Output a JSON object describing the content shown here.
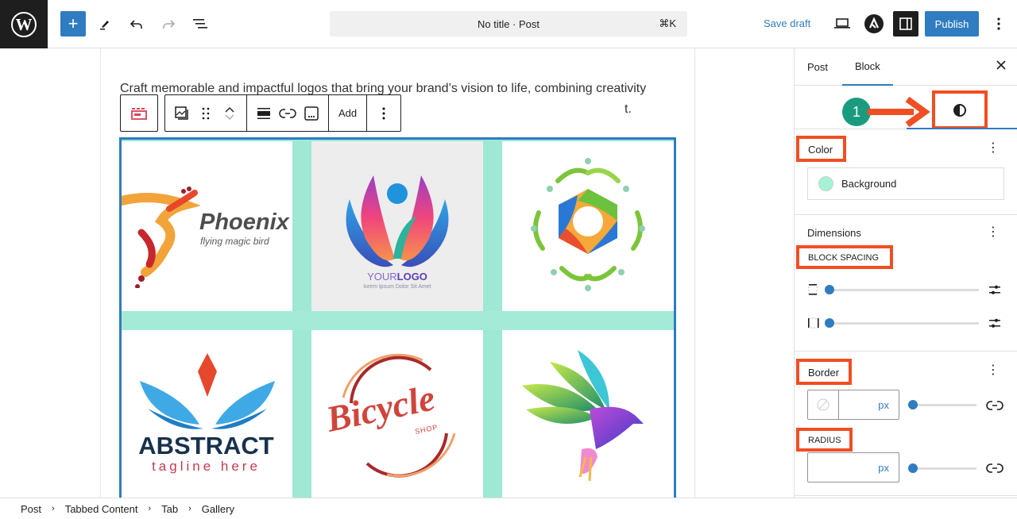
{
  "topbar": {
    "add_block_label": "+",
    "command_bar": {
      "title": "No title · Post",
      "shortcut": "⌘K"
    },
    "save_draft": "Save draft",
    "publish": "Publish"
  },
  "editor": {
    "paragraph": "Craft memorable and impactful logos that bring your brand’s vision to life, combining creativity",
    "paragraph_tail": "t.",
    "block_toolbar": {
      "add_label": "Add"
    },
    "gallery": {
      "background_color": "#a6f2d6",
      "images": [
        {
          "alt": "Phoenix logo",
          "title": "Phoenix",
          "subtitle": "flying magic bird"
        },
        {
          "alt": "Your Logo",
          "title_light": "YOUR",
          "title_bold": "LOGO",
          "subtitle": "lorem Ipsum Dolor Sit Amet"
        },
        {
          "alt": "Hexagon leaf logo"
        },
        {
          "alt": "Abstract logo",
          "title": "ABSTRACT",
          "subtitle": "tagline here"
        },
        {
          "alt": "Bicycle shop logo",
          "title": "Bicycle",
          "subtitle": "SHOP"
        },
        {
          "alt": "Colorful bird logo"
        }
      ]
    }
  },
  "sidebar": {
    "tabs": [
      {
        "label": "Post",
        "active": false
      },
      {
        "label": "Block",
        "active": true
      }
    ],
    "step_number": "1",
    "sections": {
      "color": {
        "title": "Color",
        "background_label": "Background",
        "background_swatch": "#a6f2d6"
      },
      "dimensions": {
        "title": "Dimensions",
        "block_spacing_label": "BLOCK SPACING",
        "vertical_value": 0,
        "horizontal_value": 0
      },
      "border": {
        "title": "Border",
        "width_value": "",
        "width_unit": "px",
        "width_slider": 0,
        "radius_label": "RADIUS",
        "radius_value": "",
        "radius_unit": "px",
        "radius_slider": 0
      }
    }
  },
  "breadcrumb": [
    "Post",
    "Tabbed Content",
    "Tab",
    "Gallery"
  ],
  "colors": {
    "accent": "#2f7cc0",
    "highlight": "#f04e23",
    "step": "#1a9b7d"
  }
}
